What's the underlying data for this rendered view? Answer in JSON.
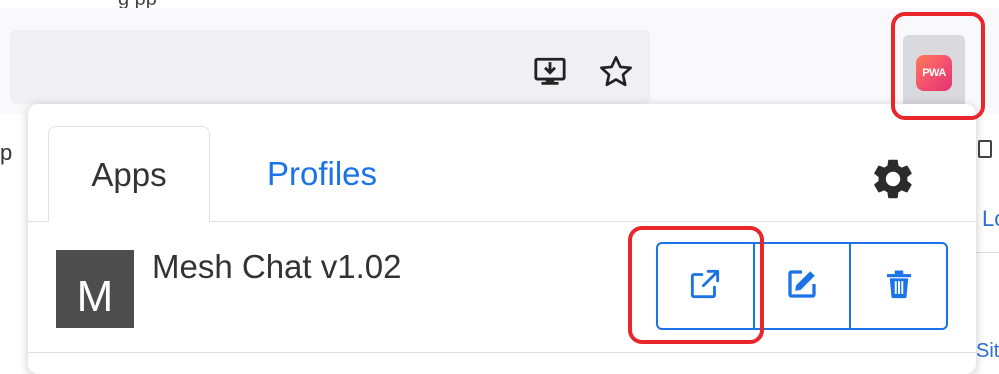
{
  "caption_fragment": "g               pp",
  "toolbar": {
    "install_icon": "install-app-icon",
    "bookmark_icon": "star-icon",
    "extension": {
      "logo_text": "PWA",
      "name": "pwa-extension"
    }
  },
  "popup": {
    "tabs": [
      {
        "label": "Apps",
        "active": true
      },
      {
        "label": "Profiles",
        "active": false
      }
    ],
    "settings_icon": "gear-icon",
    "apps": [
      {
        "avatar_letter": "M",
        "name": "Mesh Chat v1.02",
        "actions": [
          "launch-icon",
          "edit-icon",
          "delete-icon"
        ]
      }
    ]
  },
  "background_edges": {
    "left": "p",
    "right_top": "Lo",
    "right_bottom": "Sit"
  },
  "colors": {
    "accent": "#1a73e8",
    "highlight": "#e8262b",
    "avatar": "#4d4d4d",
    "pwa_gradient_start": "#ff7a59",
    "pwa_gradient_end": "#e2336d"
  }
}
